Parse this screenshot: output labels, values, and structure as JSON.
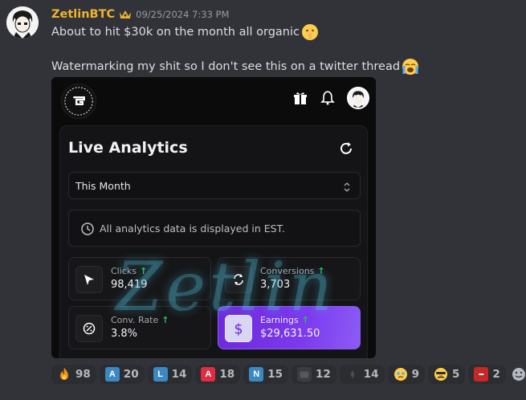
{
  "message": {
    "username": "ZetlinBTC",
    "timestamp": "09/25/2024 7:33 PM",
    "line1": "About to hit $30k on the month all organic",
    "line2": "Watermarking my shit so I don't see this on a twitter thread",
    "crown_icon": "crown-icon",
    "emoji1": "shushing-face-emoji",
    "emoji2": "crying-face-emoji"
  },
  "screenshot": {
    "panel_title": "Live Analytics",
    "period_select": "This Month",
    "notice": "All analytics data is displayed in EST.",
    "watermark": "Zetlin",
    "cards": {
      "clicks": {
        "label": "Clicks",
        "value": "98,419"
      },
      "conversions": {
        "label": "Conversions",
        "value": "3,703"
      },
      "conv_rate": {
        "label": "Conv. Rate",
        "value": "3.8%"
      },
      "earnings": {
        "label": "Earnings",
        "value": "$29,631.50"
      }
    },
    "colors": {
      "accent": "#7c3aed",
      "up_arrow": "#22c55e"
    }
  },
  "reactions": [
    {
      "emoji": "fire",
      "count": "98"
    },
    {
      "emoji": "letter-a-blue",
      "count": "20"
    },
    {
      "emoji": "letter-l",
      "count": "14"
    },
    {
      "emoji": "letter-a-red",
      "count": "18"
    },
    {
      "emoji": "letter-n",
      "count": "15"
    },
    {
      "emoji": "custom-emoji-1",
      "count": "12"
    },
    {
      "emoji": "custom-emoji-2",
      "count": "14"
    },
    {
      "emoji": "holding-back-tears",
      "count": "9"
    },
    {
      "emoji": "disguised-face",
      "count": "5"
    },
    {
      "emoji": "custom-badge",
      "count": "2"
    }
  ]
}
